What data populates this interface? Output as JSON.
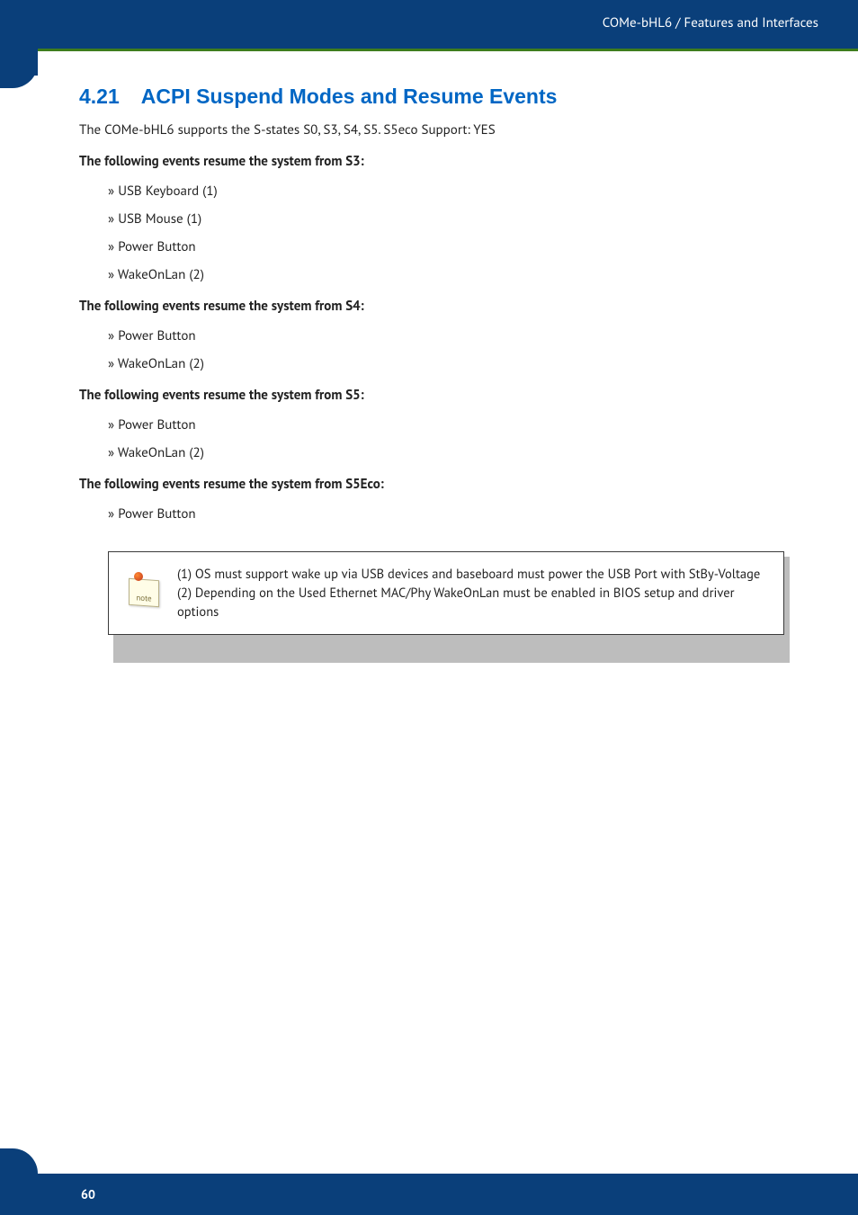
{
  "header": {
    "breadcrumb": "COMe-bHL6 / Features and Interfaces"
  },
  "section": {
    "number": "4.21",
    "title": "ACPI Suspend Modes and Resume Events",
    "intro": "The COMe-bHL6 supports the S-states S0, S3, S4, S5. S5eco Support: YES",
    "groups": [
      {
        "heading": "The following events resume the system from S3:",
        "items": [
          "USB Keyboard (1)",
          "USB Mouse (1)",
          "Power Button",
          "WakeOnLan (2)"
        ]
      },
      {
        "heading": "The following events resume the system from S4:",
        "items": [
          "Power Button",
          "WakeOnLan (2)"
        ]
      },
      {
        "heading": "The following events resume the system from S5:",
        "items": [
          "Power Button",
          "WakeOnLan (2)"
        ]
      },
      {
        "heading": "The following events resume the system from S5Eco:",
        "items": [
          "Power Button"
        ]
      }
    ]
  },
  "note": {
    "icon_label": "note",
    "line1": "(1) OS must support wake up via USB devices and baseboard must power the USB Port with StBy-Voltage",
    "line2": "(2) Depending on the Used Ethernet MAC/Phy WakeOnLan must be enabled in BIOS setup and driver options"
  },
  "footer": {
    "page_number": "60"
  }
}
